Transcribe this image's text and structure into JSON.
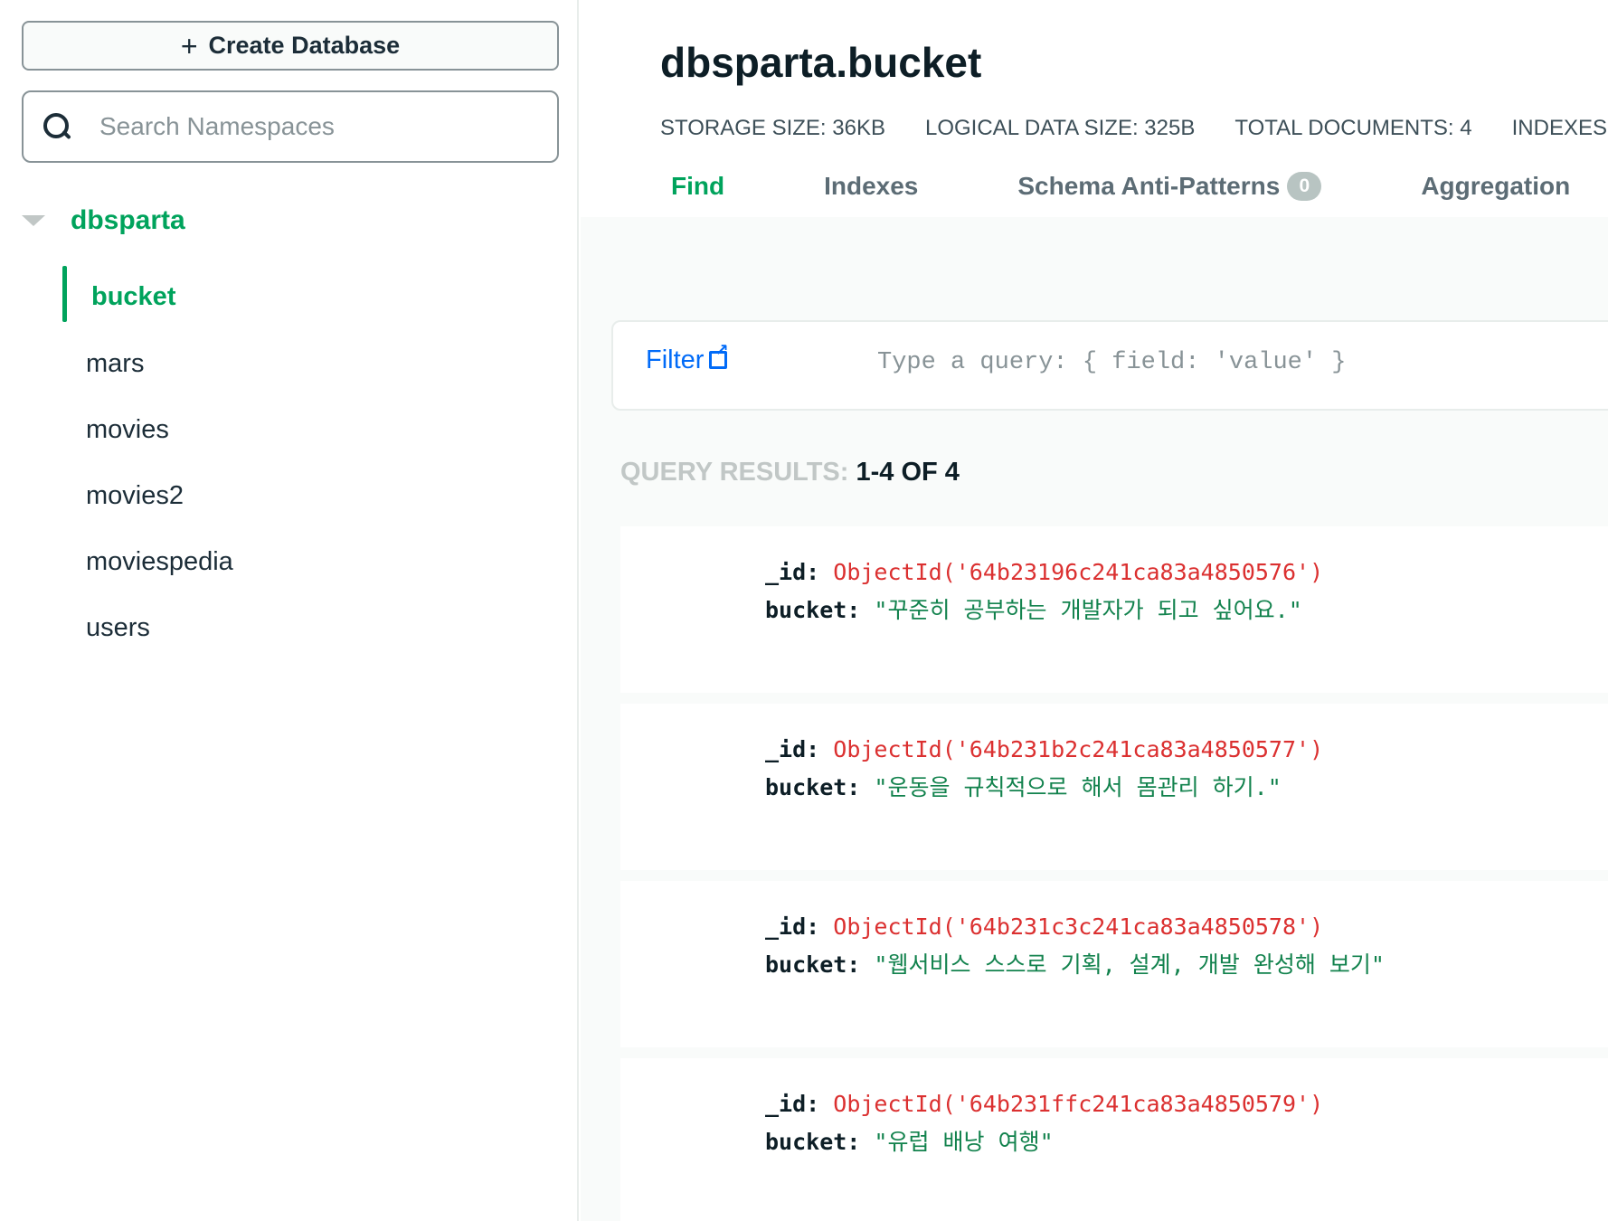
{
  "sidebar": {
    "create_button": "Create Database",
    "search_placeholder": "Search Namespaces",
    "database": "dbsparta",
    "collections": [
      "bucket",
      "mars",
      "movies",
      "movies2",
      "moviespedia",
      "users"
    ]
  },
  "header": {
    "title": "dbsparta.bucket",
    "stats": [
      {
        "key": "STORAGE SIZE:",
        "value": "36KB"
      },
      {
        "key": "LOGICAL DATA SIZE:",
        "value": "325B"
      },
      {
        "key": "TOTAL DOCUMENTS:",
        "value": "4"
      },
      {
        "key": "INDEXES T",
        "value": ""
      }
    ],
    "tabs": [
      "Find",
      "Indexes",
      "Schema Anti-Patterns",
      "Aggregation"
    ],
    "schema_badge": "0"
  },
  "filter": {
    "label": "Filter",
    "placeholder": "Type a query: { field: 'value' }"
  },
  "results": {
    "label": "QUERY RESULTS:",
    "count": "1-4 OF 4"
  },
  "documents": [
    {
      "id_key": "_id:",
      "id_value": "ObjectId('64b23196c241ca83a4850576')",
      "bucket_key": "bucket:",
      "bucket_value": "\"꾸준히 공부하는 개발자가 되고 싶어요.\""
    },
    {
      "id_key": "_id:",
      "id_value": "ObjectId('64b231b2c241ca83a4850577')",
      "bucket_key": "bucket:",
      "bucket_value": "\"운동을 규칙적으로 해서 몸관리 하기.\""
    },
    {
      "id_key": "_id:",
      "id_value": "ObjectId('64b231c3c241ca83a4850578')",
      "bucket_key": "bucket:",
      "bucket_value": "\"웹서비스 스스로 기획, 설계, 개발 완성해 보기\""
    },
    {
      "id_key": "_id:",
      "id_value": "ObjectId('64b231ffc241ca83a4850579')",
      "bucket_key": "bucket:",
      "bucket_value": "\"유럽 배낭 여행\""
    }
  ],
  "colors": {
    "accent_green": "#00a35c",
    "link_blue": "#016bf8",
    "object_id_red": "#db3030",
    "string_green": "#12824d"
  }
}
